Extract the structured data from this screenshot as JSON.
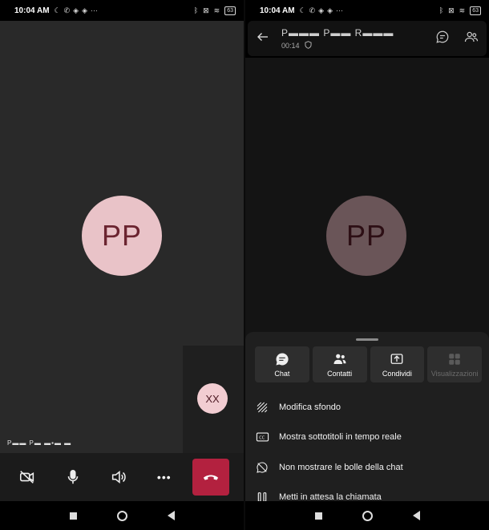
{
  "status_bar": {
    "time": "10:04 AM",
    "more": "···",
    "battery": "63"
  },
  "left_screen": {
    "remote_avatar_initials": "PP",
    "self_avatar_initials": "XX",
    "caller_name": "P▬▬ P▬ ▬▪▬ ▬",
    "controls": {
      "camera_icon": "video-off-icon",
      "mic_icon": "microphone-icon",
      "speaker_icon": "speaker-icon",
      "more_label": "•••",
      "hangup_icon": "phone-hangup-icon"
    }
  },
  "right_screen": {
    "header": {
      "caller_name": "P▬▬▬ P▬▬ R▬▬▬",
      "duration": "00:14"
    },
    "remote_avatar_initials": "PP",
    "tiles": [
      {
        "label": "Chat",
        "icon": "chat-bubble-icon",
        "enabled": true
      },
      {
        "label": "Contatti",
        "icon": "people-icon",
        "enabled": true
      },
      {
        "label": "Condividi",
        "icon": "share-upload-icon",
        "enabled": true
      },
      {
        "label": "Visualizzazioni",
        "icon": "grid-view-icon",
        "enabled": false
      }
    ],
    "menu_items": [
      {
        "label": "Modifica sfondo",
        "icon": "background-effects-icon"
      },
      {
        "label": "Mostra sottotitoli in tempo reale",
        "icon": "closed-captions-icon"
      },
      {
        "label": "Non mostrare le bolle della chat",
        "icon": "chat-off-icon"
      },
      {
        "label": "Metti in attesa la chiamata",
        "icon": "pause-icon"
      }
    ]
  },
  "colors": {
    "accent_hangup": "#b3213f",
    "avatar_bg": "#e9c3c8",
    "avatar_text": "#6b2430"
  }
}
